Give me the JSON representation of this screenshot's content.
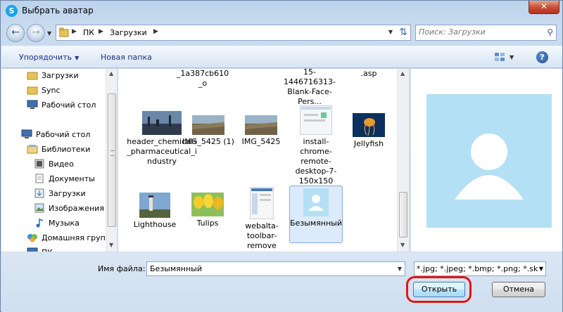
{
  "window": {
    "title": "Выбрать аватар",
    "close_symbol": "✕"
  },
  "address_bar": {
    "crumbs": [
      "ПК",
      "Загрузки"
    ]
  },
  "search": {
    "placeholder": "Поиск: Загрузки"
  },
  "toolbar": {
    "organize_label": "Упорядочить",
    "new_folder_label": "Новая папка",
    "help_symbol": "?"
  },
  "nav_pane": {
    "items": [
      {
        "label": "Загрузки",
        "icon": "folder-icon"
      },
      {
        "label": "Sync",
        "icon": "folder-icon"
      },
      {
        "label": "Рабочий стол",
        "icon": "desktop-icon"
      },
      {
        "label": "Рабочий стол",
        "icon": "desktop-icon"
      },
      {
        "label": "Библиотеки",
        "icon": "libraries-icon"
      },
      {
        "label": "Видео",
        "icon": "video-icon"
      },
      {
        "label": "Документы",
        "icon": "documents-icon"
      },
      {
        "label": "Загрузки",
        "icon": "downloads-icon"
      },
      {
        "label": "Изображения",
        "icon": "pictures-icon"
      },
      {
        "label": "Музыка",
        "icon": "music-icon"
      },
      {
        "label": "Домашняя груп",
        "icon": "homegroup-icon"
      },
      {
        "label": "ПК",
        "icon": "computer-icon"
      }
    ]
  },
  "files": [
    {
      "name": "_1a387cb610_o",
      "thumb": "image-thumb"
    },
    {
      "name": "15-1446716313-Blank-Face-Pers...",
      "thumb": "image-thumb"
    },
    {
      "name": ".asp",
      "thumb": "image-thumb"
    },
    {
      "name": "header_chemicals_pharmaceutical_industry",
      "thumb": "industry-thumb"
    },
    {
      "name": "IMG_5425 (1)",
      "thumb": "landscape-thumb"
    },
    {
      "name": "IMG_5425",
      "thumb": "landscape-thumb"
    },
    {
      "name": "install-chrome-remote-desktop-7-150x150",
      "thumb": "screenshot-thumb"
    },
    {
      "name": "Jellyfish",
      "thumb": "jellyfish-thumb"
    },
    {
      "name": "Lighthouse",
      "thumb": "lighthouse-thumb"
    },
    {
      "name": "Tulips",
      "thumb": "tulips-thumb"
    },
    {
      "name": "webalta-toolbar-remove",
      "thumb": "screenshot-thumb"
    },
    {
      "name": "Безымянный",
      "thumb": "avatar-thumb"
    }
  ],
  "bottom": {
    "filename_label": "Имя файла:",
    "filename_value": "Безымянный",
    "filter_value": "*.jpg; *.jpeg; *.bmp; *.png; *.sk",
    "open_label": "Открыть",
    "cancel_label": "Отмена"
  },
  "colors": {
    "highlight": "#e01717",
    "preview_bg": "#b3e0f5"
  }
}
